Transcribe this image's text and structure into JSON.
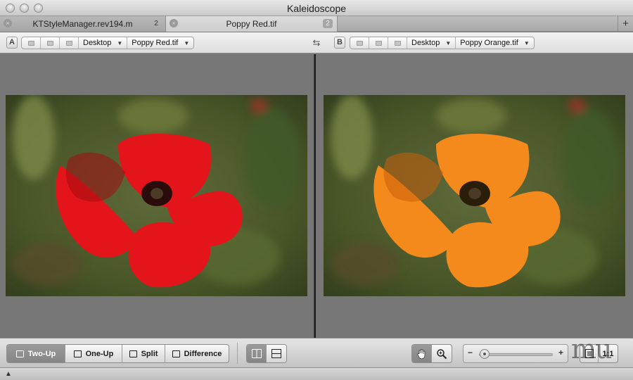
{
  "window": {
    "title": "Kaleidoscope"
  },
  "tabs": [
    {
      "label": "KTStyleManager.rev194.m",
      "count": "2",
      "active": false
    },
    {
      "label": "Poppy Red.tif",
      "count": "2",
      "active": true
    }
  ],
  "icons": {
    "add_tab": "+",
    "swap": "⇆",
    "close": "×",
    "status_expand": "▲"
  },
  "left_path": {
    "side": "A",
    "folder": "Desktop",
    "file": "Poppy Red.tif"
  },
  "right_path": {
    "side": "B",
    "folder": "Desktop",
    "file": "Poppy Orange.tif"
  },
  "images": {
    "left": {
      "petal_color": "#e4151a",
      "petal_shadow": "#a40c10"
    },
    "right": {
      "petal_color": "#f58a1c",
      "petal_shadow": "#c85e0d"
    }
  },
  "toolbar": {
    "modes": [
      {
        "label": "Two-Up",
        "selected": true
      },
      {
        "label": "One-Up",
        "selected": false
      },
      {
        "label": "Split",
        "selected": false
      },
      {
        "label": "Difference",
        "selected": false
      }
    ],
    "layout": [
      "side-by-side",
      "stacked"
    ],
    "tools": [
      "hand-tool",
      "zoom-tool"
    ],
    "zoom_minus": "−",
    "zoom_plus": "+",
    "zoom_level": 0.08,
    "actual_size": "1:1"
  },
  "watermark": "mu"
}
